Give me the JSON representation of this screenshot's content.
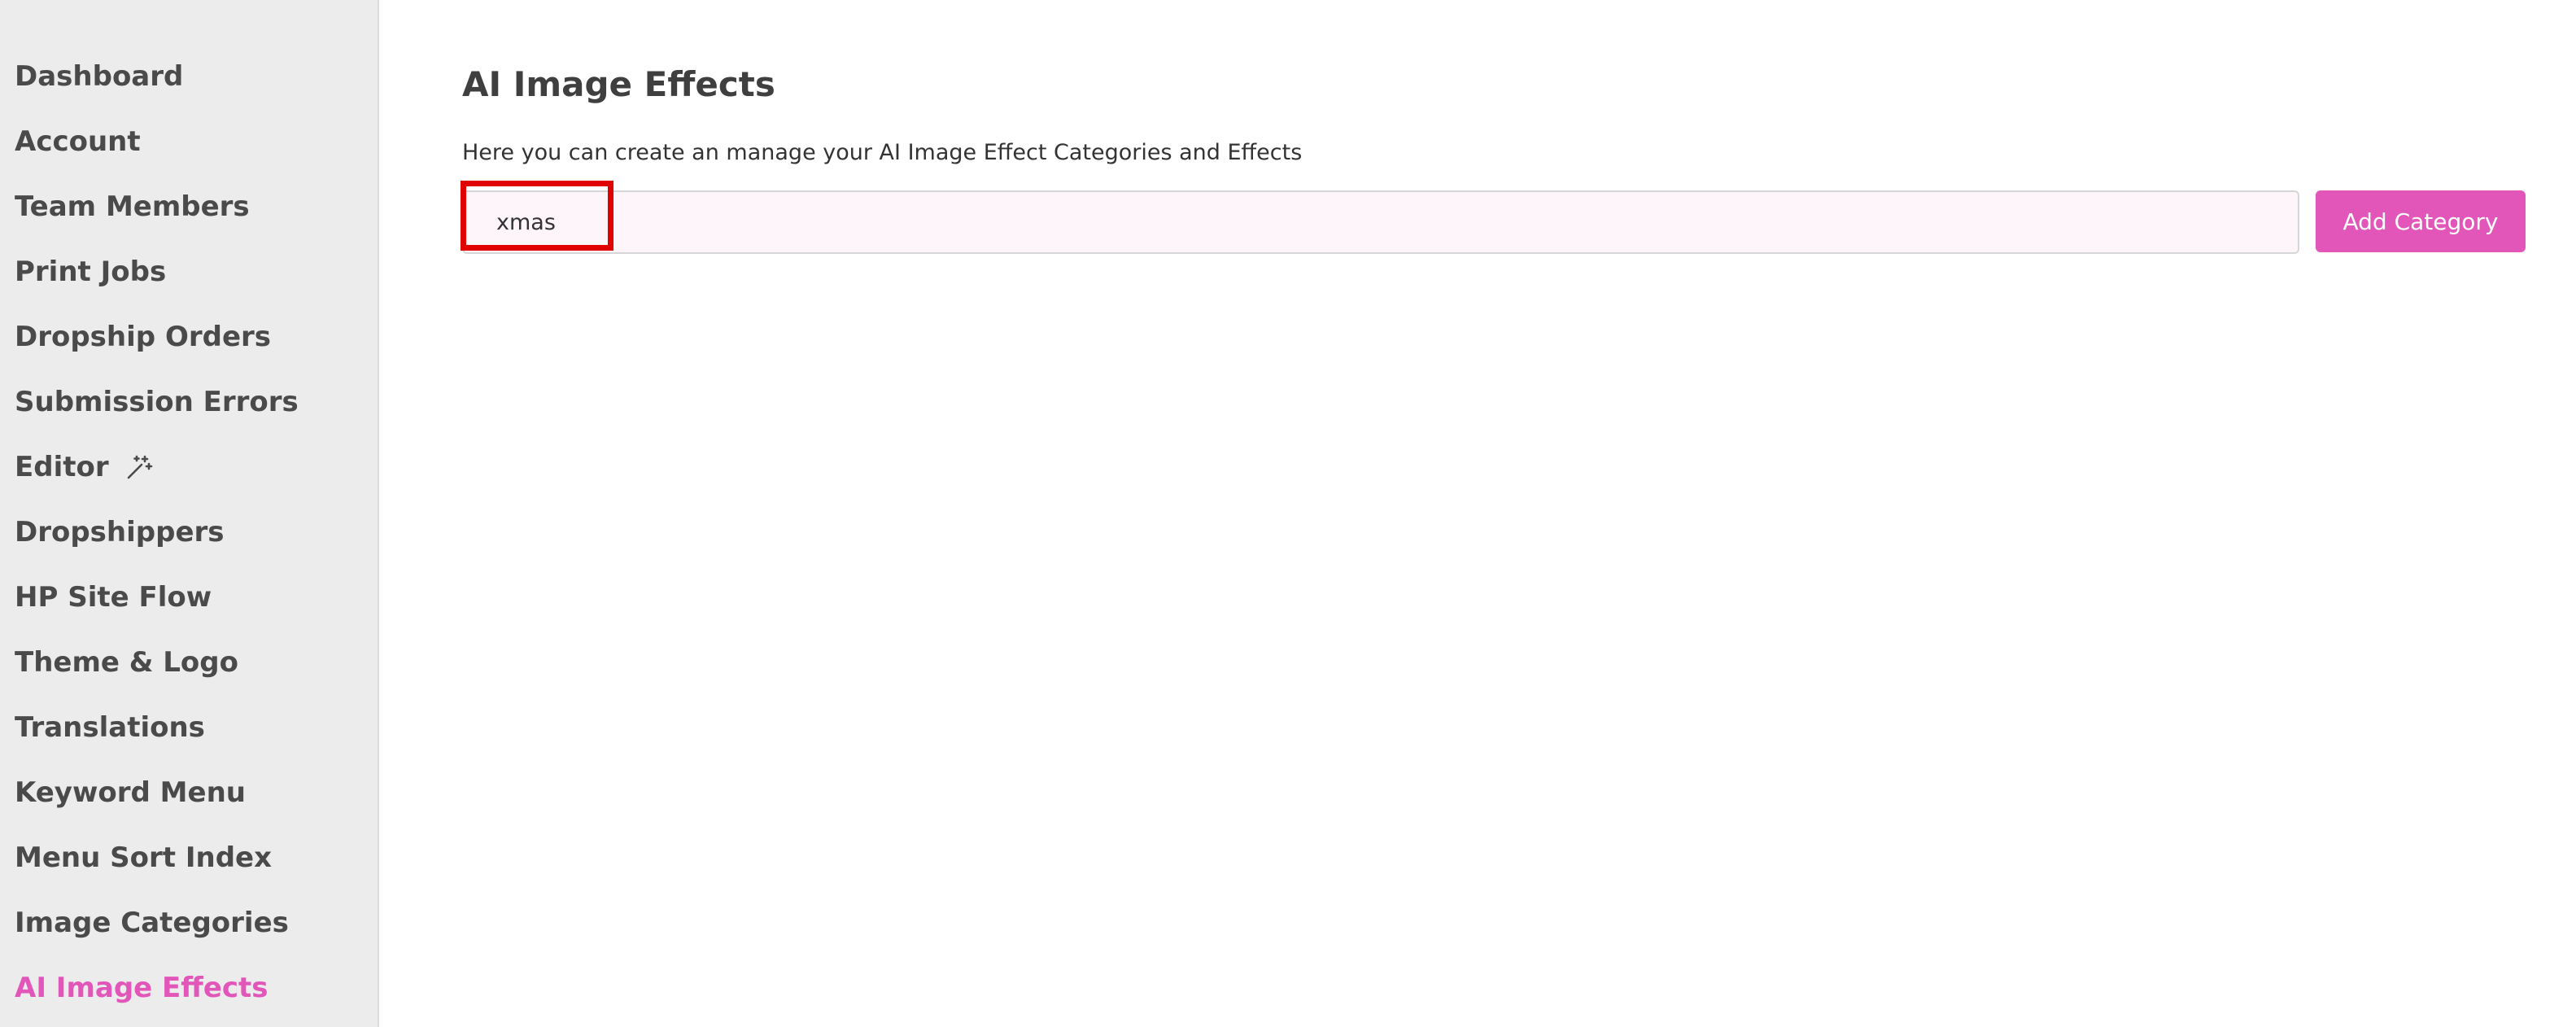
{
  "sidebar": {
    "items": [
      {
        "label": "Dashboard",
        "active": false
      },
      {
        "label": "Account",
        "active": false
      },
      {
        "label": "Team Members",
        "active": false
      },
      {
        "label": "Print Jobs",
        "active": false
      },
      {
        "label": "Dropship Orders",
        "active": false
      },
      {
        "label": "Submission Errors",
        "active": false
      },
      {
        "label": "Editor",
        "icon": "magic-wand-icon",
        "active": false
      },
      {
        "label": "Dropshippers",
        "active": false
      },
      {
        "label": "HP Site Flow",
        "active": false
      },
      {
        "label": "Theme & Logo",
        "active": false
      },
      {
        "label": "Translations",
        "active": false
      },
      {
        "label": "Keyword Menu",
        "active": false
      },
      {
        "label": "Menu Sort Index",
        "active": false
      },
      {
        "label": "Image Categories",
        "active": false
      },
      {
        "label": "AI Image Effects",
        "active": true
      }
    ]
  },
  "main": {
    "title": "AI Image Effects",
    "description": "Here you can create an manage your AI Image Effect Categories and Effects",
    "category_input": {
      "value": "xmas",
      "placeholder": ""
    },
    "add_button_label": "Add Category"
  },
  "colors": {
    "accent": "#e255b9",
    "sidebar_bg": "#ececec",
    "input_bg": "#fdf5fa",
    "highlight": "#e00000"
  }
}
